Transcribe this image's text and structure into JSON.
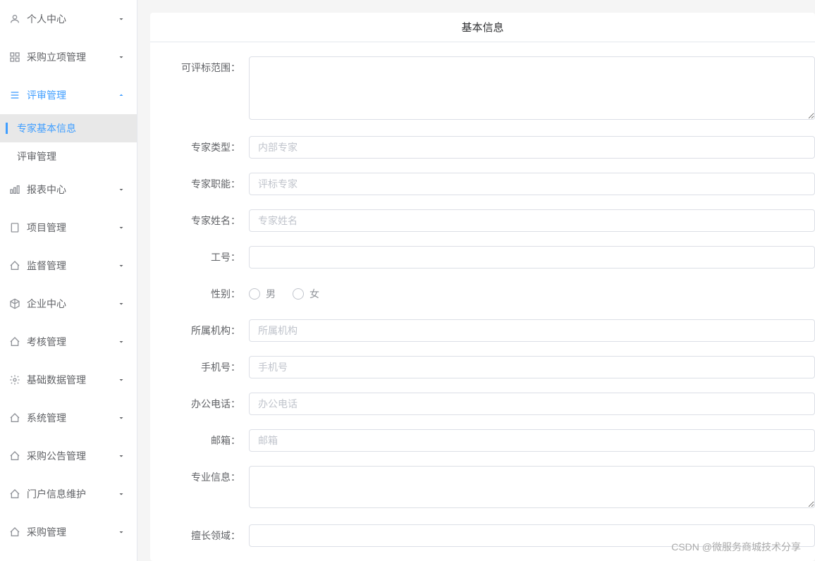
{
  "sidebar": {
    "items": [
      {
        "label": "个人中心",
        "icon": "user",
        "expanded": false
      },
      {
        "label": "采购立项管理",
        "icon": "grid",
        "expanded": false
      },
      {
        "label": "评审管理",
        "icon": "list",
        "expanded": true,
        "active": true,
        "children": [
          {
            "label": "专家基本信息",
            "active": true
          },
          {
            "label": "评审管理",
            "active": false
          }
        ]
      },
      {
        "label": "报表中心",
        "icon": "chart",
        "expanded": false
      },
      {
        "label": "项目管理",
        "icon": "doc",
        "expanded": false
      },
      {
        "label": "监督管理",
        "icon": "house",
        "expanded": false
      },
      {
        "label": "企业中心",
        "icon": "cube",
        "expanded": false
      },
      {
        "label": "考核管理",
        "icon": "house",
        "expanded": false
      },
      {
        "label": "基础数据管理",
        "icon": "gear",
        "expanded": false
      },
      {
        "label": "系统管理",
        "icon": "house",
        "expanded": false
      },
      {
        "label": "采购公告管理",
        "icon": "house",
        "expanded": false
      },
      {
        "label": "门户信息维护",
        "icon": "house",
        "expanded": false
      },
      {
        "label": "采购管理",
        "icon": "house",
        "expanded": false
      }
    ]
  },
  "tab": {
    "title": "基本信息"
  },
  "form": {
    "fields": [
      {
        "label": "可评标范围：",
        "type": "textarea",
        "placeholder": ""
      },
      {
        "label": "专家类型：",
        "type": "input",
        "placeholder": "内部专家"
      },
      {
        "label": "专家职能：",
        "type": "input",
        "placeholder": "评标专家"
      },
      {
        "label": "专家姓名：",
        "type": "input",
        "placeholder": "专家姓名"
      },
      {
        "label": "工号：",
        "type": "input",
        "placeholder": ""
      },
      {
        "label": "性别：",
        "type": "radio",
        "options": [
          "男",
          "女"
        ]
      },
      {
        "label": "所属机构：",
        "type": "input",
        "placeholder": "所属机构"
      },
      {
        "label": "手机号：",
        "type": "input",
        "placeholder": "手机号"
      },
      {
        "label": "办公电话：",
        "type": "input",
        "placeholder": "办公电话"
      },
      {
        "label": "邮箱：",
        "type": "input",
        "placeholder": "邮箱"
      },
      {
        "label": "专业信息：",
        "type": "textarea",
        "placeholder": ""
      },
      {
        "label": "擅长领域：",
        "type": "input",
        "placeholder": ""
      }
    ]
  },
  "watermark": "CSDN @微服务商城技术分享"
}
